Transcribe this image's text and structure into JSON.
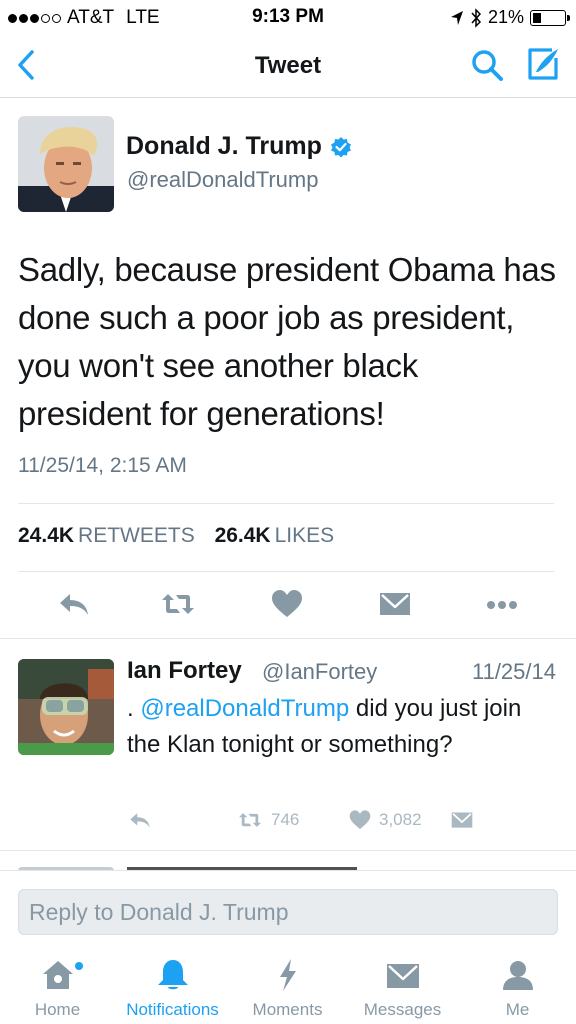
{
  "status_bar": {
    "carrier": "AT&T",
    "network": "LTE",
    "time": "9:13 PM",
    "battery": "21%"
  },
  "nav": {
    "title": "Tweet",
    "back_icon": "chevron-left-icon",
    "search_icon": "search-icon",
    "compose_icon": "compose-icon"
  },
  "tweet": {
    "author_name": "Donald J. Trump",
    "author_handle": "@realDonaldTrump",
    "text": "Sadly, because president Obama has done such a poor job as president, you won't see another black president for generations!",
    "timestamp": "11/25/14, 2:15 AM",
    "retweets_count": "24.4K",
    "retweets_label": "RETWEETS",
    "likes_count": "26.4K",
    "likes_label": "LIKES"
  },
  "reply": {
    "author_name": "Ian Fortey",
    "author_handle": "@IanFortey",
    "date": "11/25/14",
    "prefix": ". ",
    "mention": "@realDonaldTrump",
    "text": " did you just join the Klan tonight or something?",
    "retweets": "746",
    "likes": "3,082"
  },
  "reply_box": {
    "placeholder": "Reply to Donald J. Trump"
  },
  "tabs": [
    {
      "label": "Home",
      "icon": "home-icon"
    },
    {
      "label": "Notifications",
      "icon": "bell-icon"
    },
    {
      "label": "Moments",
      "icon": "lightning-icon"
    },
    {
      "label": "Messages",
      "icon": "envelope-icon"
    },
    {
      "label": "Me",
      "icon": "person-icon"
    }
  ],
  "colors": {
    "accent": "#1da1f2",
    "text": "#14171a",
    "secondary": "#657786",
    "icon_gray": "#8899a6"
  }
}
